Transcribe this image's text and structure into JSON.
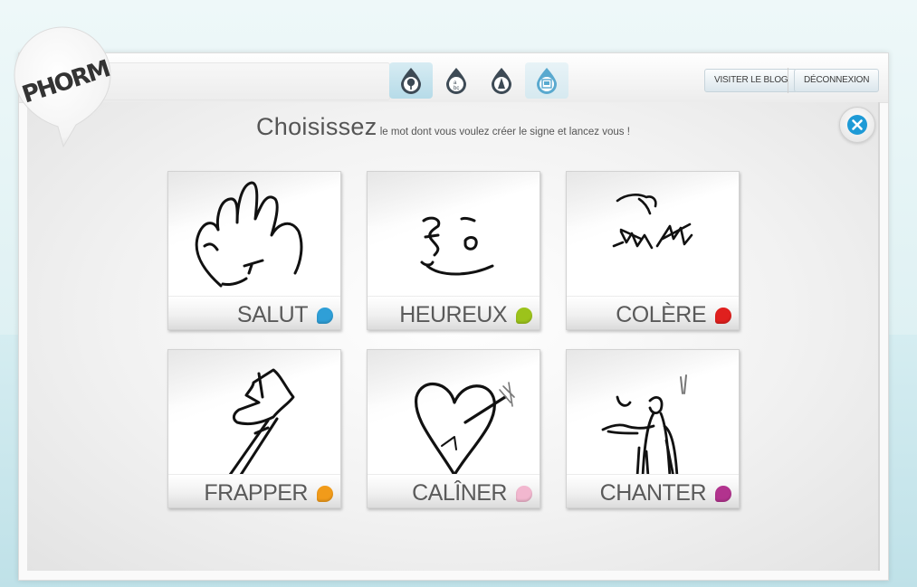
{
  "logo": {
    "text": "PHORM"
  },
  "topbar": {
    "tools": [
      {
        "icon": "tree-icon",
        "active": true
      },
      {
        "icon": "alphabet-icon",
        "active": false
      },
      {
        "icon": "draw-icon",
        "active": false
      },
      {
        "icon": "gallery-icon",
        "active": false
      }
    ],
    "blog_label": "VISITER LE BLOG",
    "logout_label": "DÉCONNEXION"
  },
  "heading": {
    "big": "Choisissez",
    "small": " le mot dont vous voulez créer le signe et lancez vous !"
  },
  "cards": [
    {
      "label": "SALUT",
      "color": "#2f9fd7"
    },
    {
      "label": "HEUREUX",
      "color": "#9cc31b"
    },
    {
      "label": "COLÈRE",
      "color": "#e0201e"
    },
    {
      "label": "FRAPPER",
      "color": "#f19b1a"
    },
    {
      "label": "CALÎNER",
      "color": "#f2b7cf"
    },
    {
      "label": "CHANTER",
      "color": "#b2338e"
    }
  ]
}
